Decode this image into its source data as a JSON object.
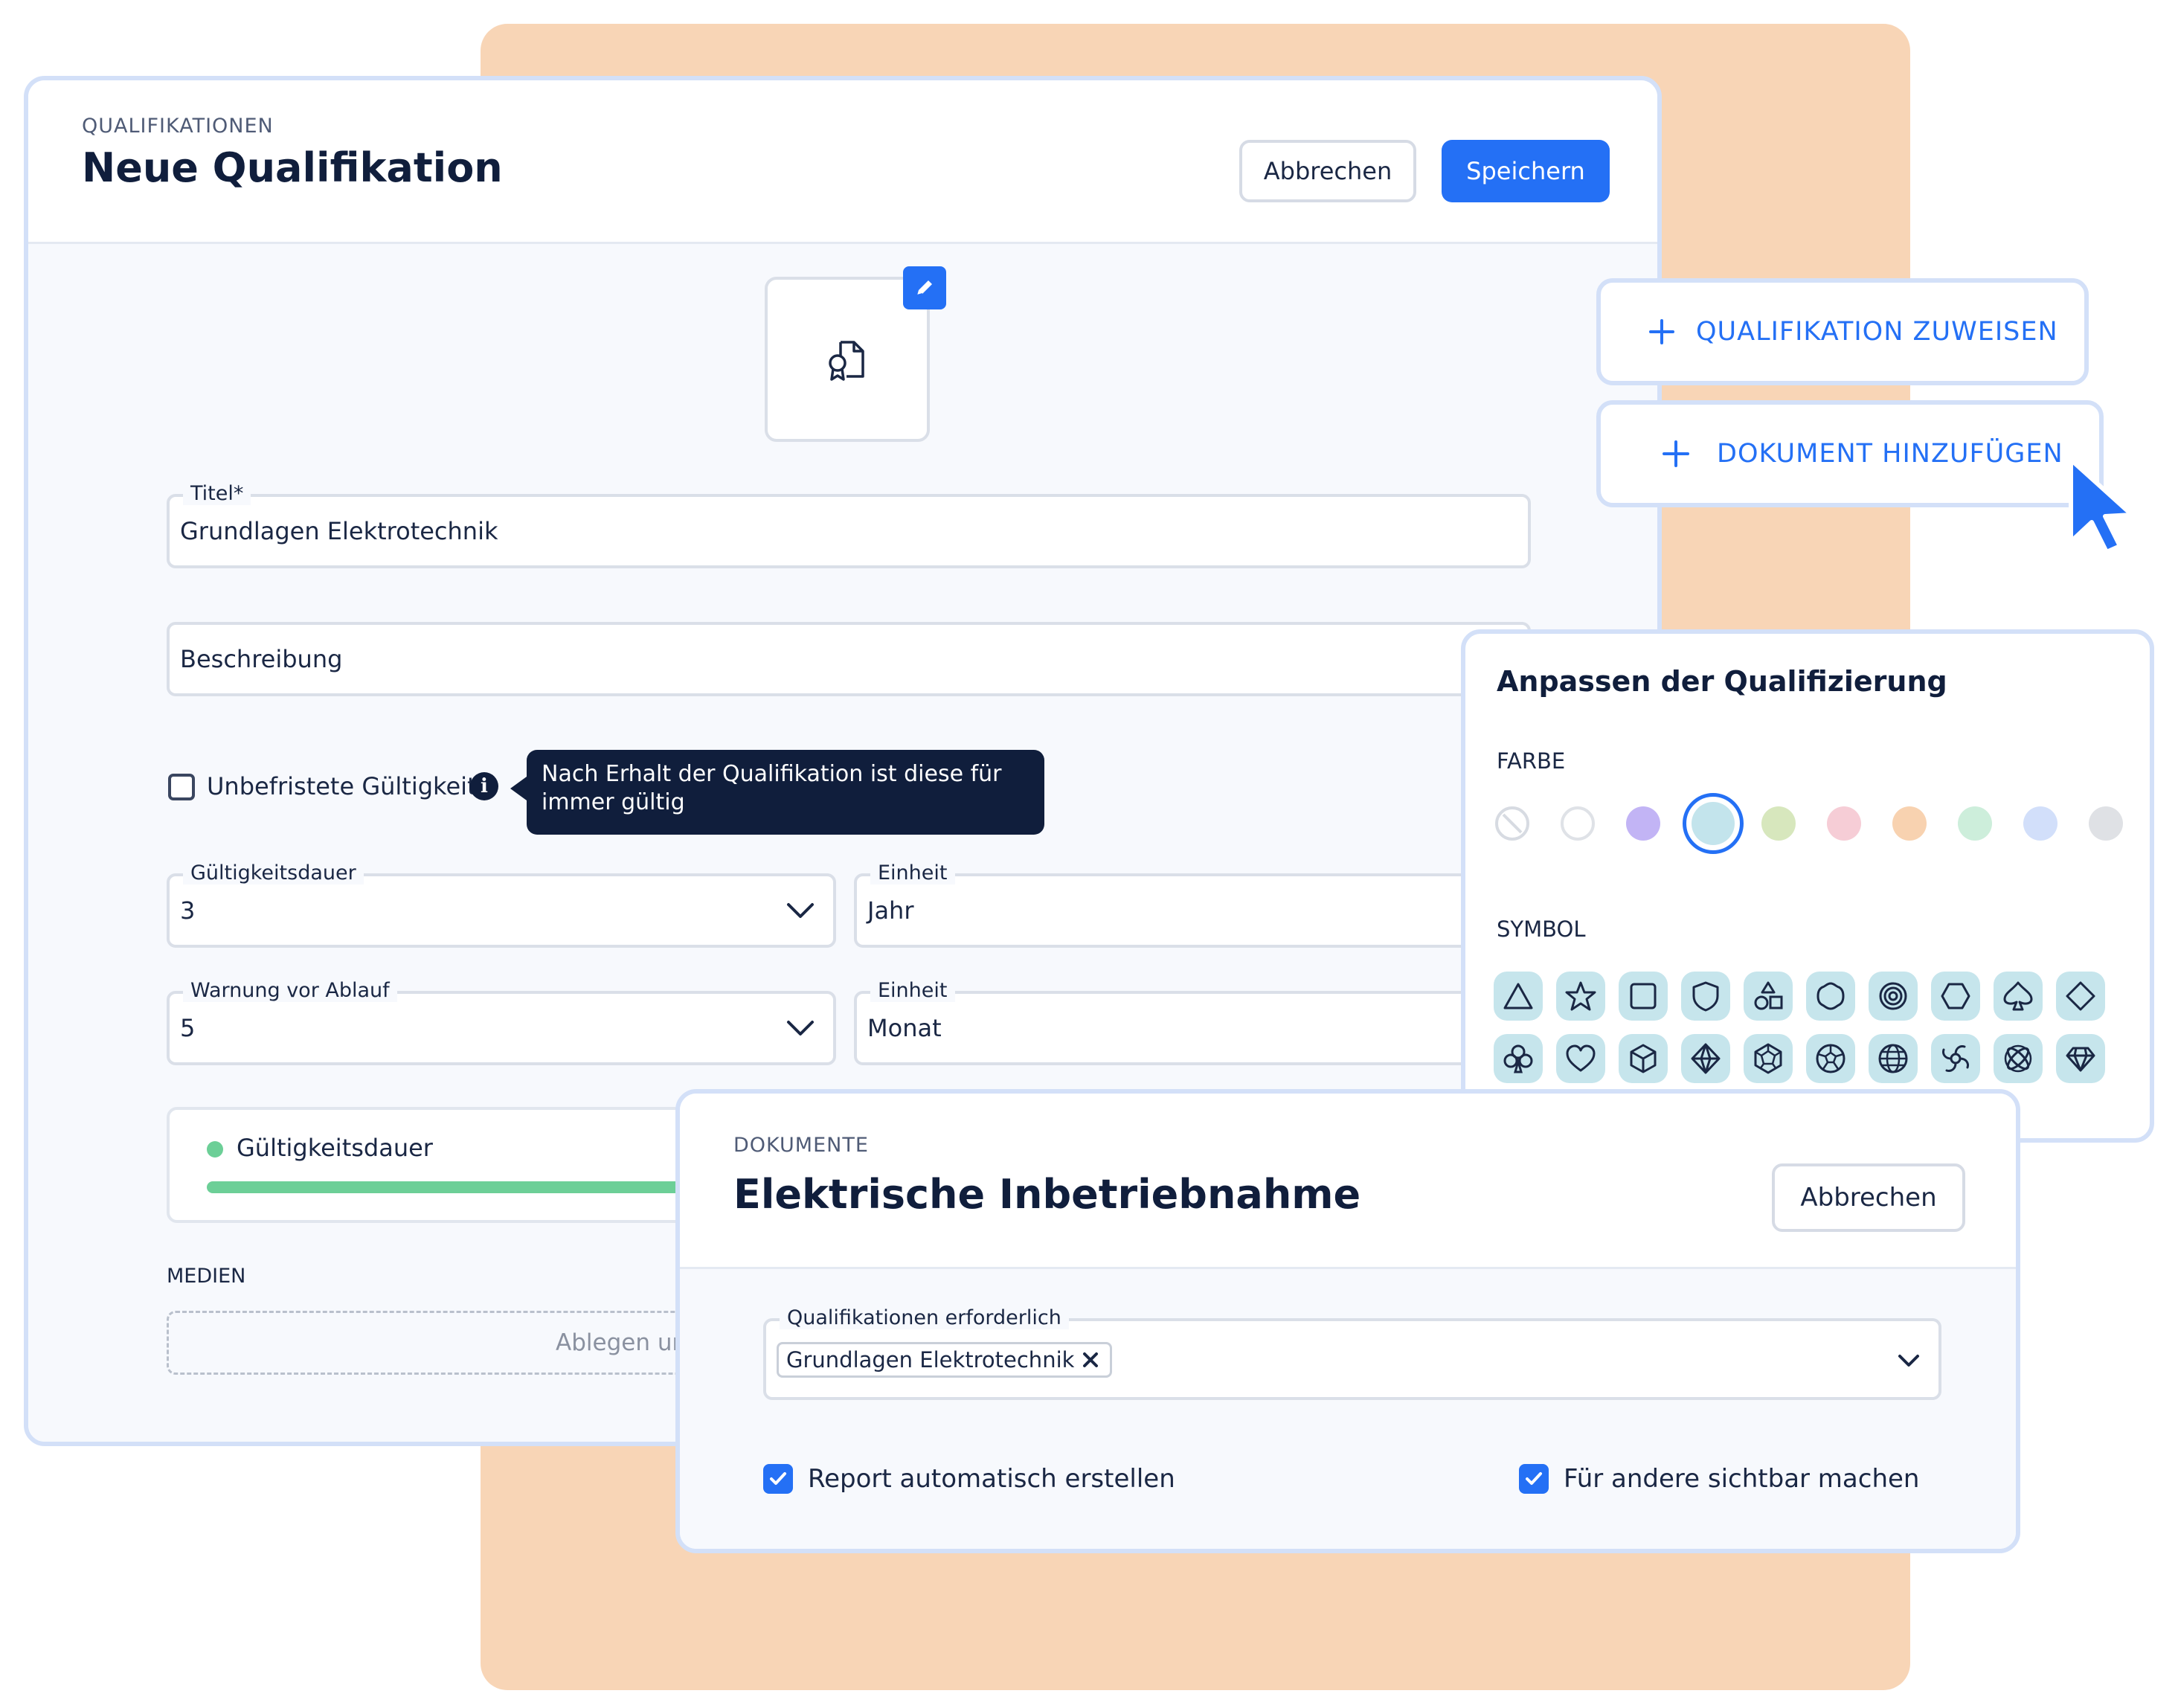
{
  "qualification_form": {
    "eyebrow": "QUALIFIKATIONEN",
    "title": "Neue Qualifikation",
    "cancel_label": "Abbrechen",
    "save_label": "Speichern",
    "title_field": {
      "label": "Titel*",
      "value": "Grundlagen Elektrotechnik"
    },
    "description_field": {
      "placeholder": "Beschreibung"
    },
    "unlimited_checkbox": {
      "label": "Unbefristete Gültigkeit",
      "checked": false
    },
    "tooltip": "Nach Erhalt der Qualifikation ist diese für immer gültig",
    "validity": {
      "label": "Gültigkeitsdauer",
      "value": "3"
    },
    "validity_unit": {
      "label": "Einheit",
      "value": "Jahr"
    },
    "warning": {
      "label": "Warnung vor Ablauf",
      "value": "5"
    },
    "warning_unit": {
      "label": "Einheit",
      "value": "Monat"
    },
    "legend": {
      "label": "Gültigkeitsdauer",
      "color": "#6ccf97"
    },
    "media_label": "MEDIEN",
    "dropzone_text": "Ablegen ur"
  },
  "actions": {
    "assign_label": "QUALIFIKATION ZUWEISEN",
    "add_document_label": "DOKUMENT HINZUFÜGEN"
  },
  "customize": {
    "title": "Anpassen der Qualifizierung",
    "color_label": "FARBE",
    "colors": [
      "none",
      "#ffffff",
      "#c2b4f5",
      "#c3e4ec",
      "#d7e7bd",
      "#f6cdd6",
      "#f8d2b0",
      "#cdeedb",
      "#d2dffa",
      "#dfe1e5"
    ],
    "selected_color": "#c3e4ec",
    "symbol_label": "SYMBOL",
    "symbols": [
      "triangle-icon",
      "star-icon",
      "square-icon",
      "shield-icon",
      "shapes-icon",
      "flower-icon",
      "target-icon",
      "hexagon-icon",
      "spade-icon",
      "diamond-icon",
      "club-icon",
      "heart-icon",
      "cube-icon",
      "pyramid-icon",
      "dodecahedron-icon",
      "football-icon",
      "globe-icon",
      "aperture-icon",
      "atom-icon",
      "gem-icon"
    ]
  },
  "documents": {
    "eyebrow": "DOKUMENTE",
    "title": "Elektrische Inbetriebnahme",
    "cancel_label": "Abbrechen",
    "required_field": {
      "label": "Qualifikationen erforderlich",
      "chip": "Grundlagen Elektrotechnik"
    },
    "report_checkbox": {
      "label": "Report automatisch erstellen",
      "checked": true
    },
    "visible_checkbox": {
      "label": "Für andere sichtbar machen",
      "checked": true
    }
  },
  "colors": {
    "accent": "#2470f5",
    "peach": "#f8d5b6",
    "border": "#d3e0f8",
    "dark": "#101e3c"
  }
}
